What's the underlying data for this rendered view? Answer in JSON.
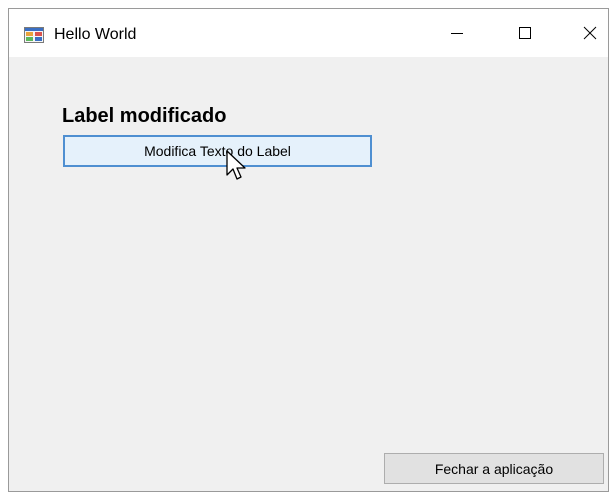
{
  "window": {
    "title": "Hello World",
    "icon": "winforms-app-icon"
  },
  "caption_buttons": {
    "minimize_icon": "minimize-icon",
    "maximize_icon": "maximize-icon",
    "close_icon": "close-icon"
  },
  "form": {
    "label_text": "Label modificado",
    "modify_button_label": "Modifica Texto do Label",
    "close_button_label": "Fechar a aplicação"
  },
  "colors": {
    "window_bg": "#f0f0f0",
    "titlebar_bg": "#ffffff",
    "hover_button_bg": "#e5f1fb",
    "hover_button_border": "#4f8fd1",
    "button_bg": "#e1e1e1"
  }
}
